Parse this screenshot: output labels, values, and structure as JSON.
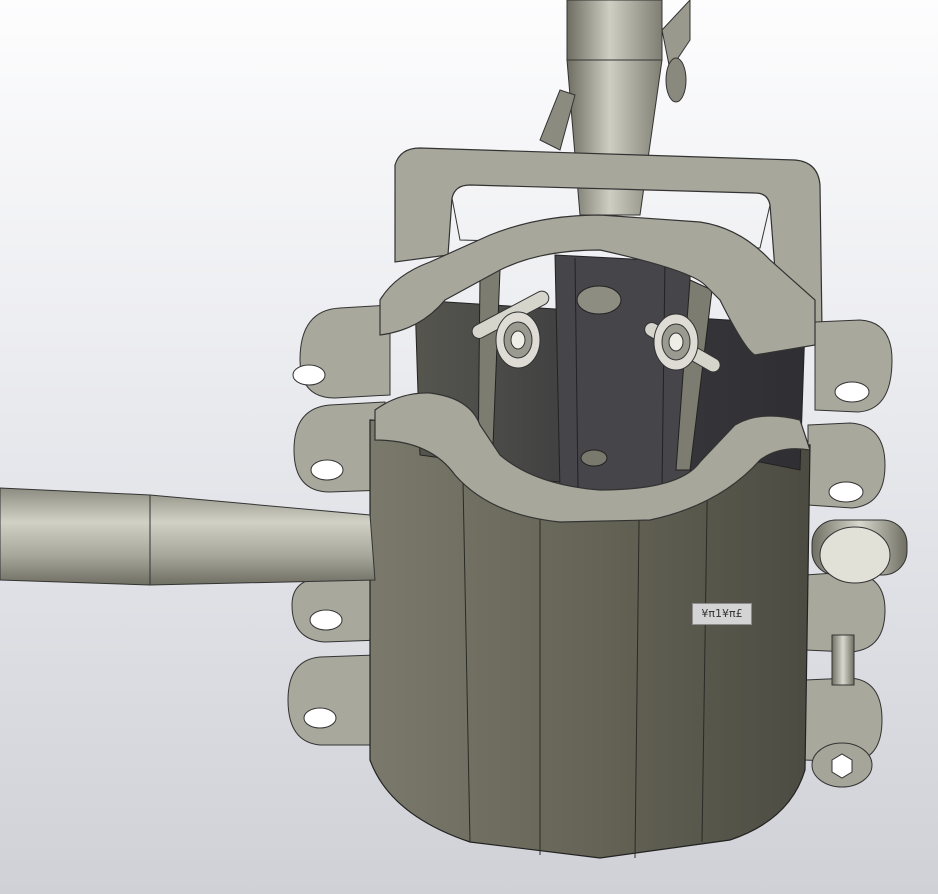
{
  "viewport": {
    "background_top": "#fdfdfe",
    "background_bottom": "#cfd1d7"
  },
  "model": {
    "body_color": "#6b6a5c",
    "face_color": "#a7a69a",
    "cavity_color": "#3c3c40",
    "shaft_color": "#b3b2a6",
    "bearing_color": "#d8d7cf"
  },
  "annotation": {
    "label": "¥π1¥π£",
    "icon": "3d-annotation-tag"
  }
}
